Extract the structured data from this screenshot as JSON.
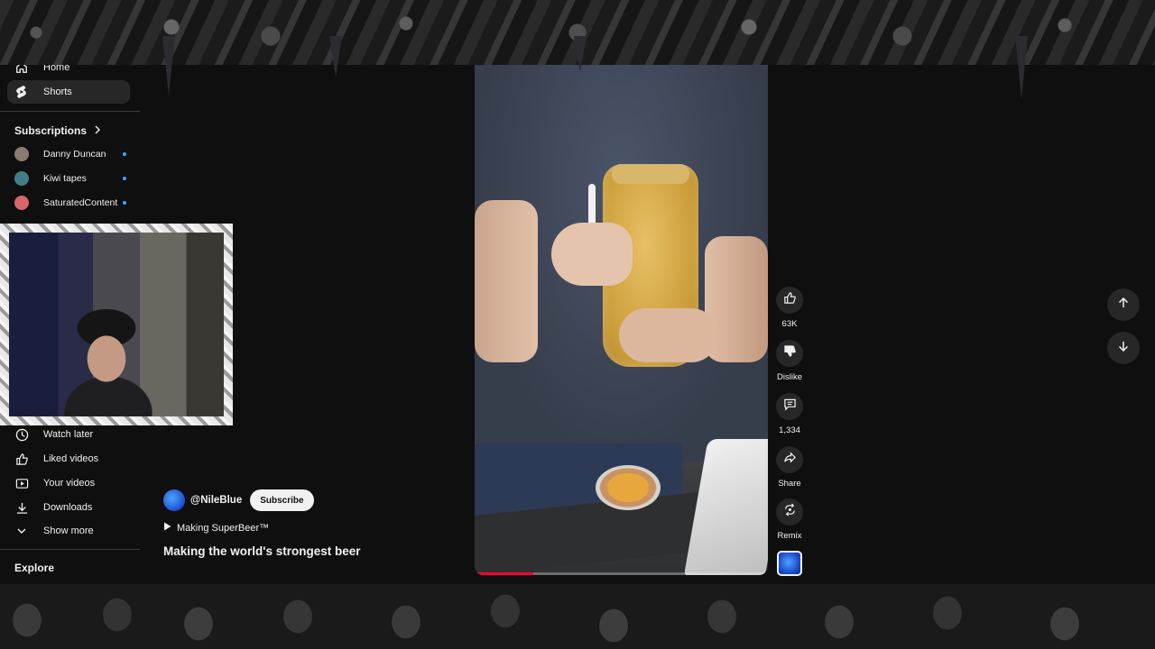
{
  "sidebar": {
    "home_label": "Home",
    "shorts_label": "Shorts",
    "subscriptions_title": "Subscriptions",
    "subscriptions": [
      {
        "name": "Danny Duncan",
        "color": "#8a7a70"
      },
      {
        "name": "Kiwi tapes",
        "color": "#3f7f86"
      },
      {
        "name": "SaturatedContent",
        "color": "#d9646b"
      }
    ],
    "you_items": [
      {
        "label": "Watch later",
        "icon": "clock-icon"
      },
      {
        "label": "Liked videos",
        "icon": "thumbs-up-icon"
      },
      {
        "label": "Your videos",
        "icon": "play-square-icon"
      },
      {
        "label": "Downloads",
        "icon": "download-icon"
      },
      {
        "label": "Show more",
        "icon": "chevron-down-icon"
      }
    ],
    "explore_title": "Explore"
  },
  "short": {
    "channel_handle": "@NileBlue",
    "subscribe_label": "Subscribe",
    "playlist_label": "Making SuperBeer™",
    "title": "Making the world's strongest beer",
    "progress": 0.2
  },
  "actions": {
    "like_count": "63K",
    "dislike_label": "Dislike",
    "comment_count": "1,334",
    "share_label": "Share",
    "remix_label": "Remix"
  },
  "colors": {
    "background": "#0f0f0f",
    "accent_red": "#ff0033",
    "badge_blue": "#3ea6ff"
  }
}
